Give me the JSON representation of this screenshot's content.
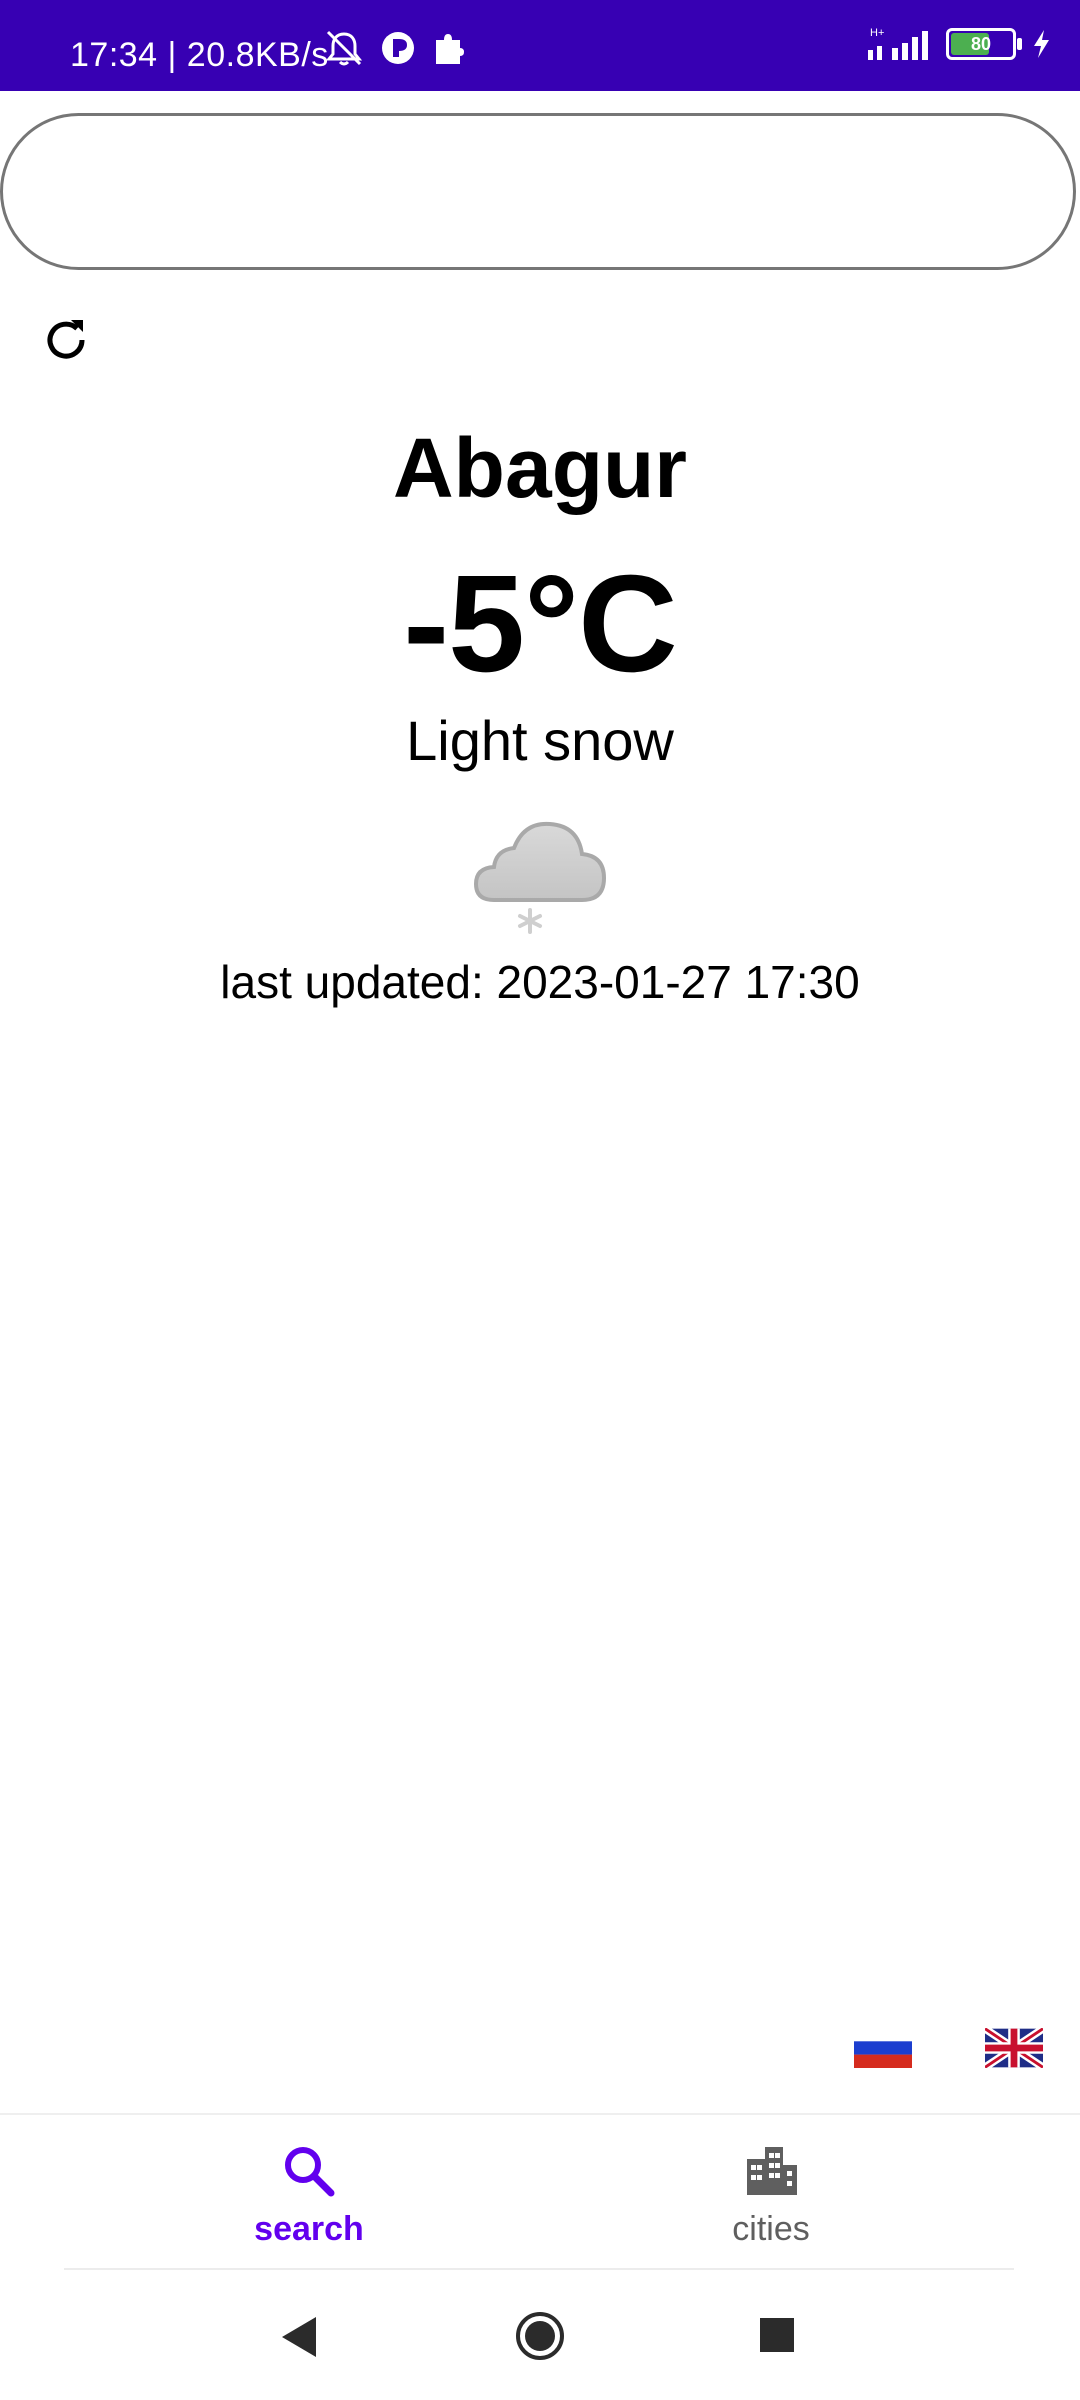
{
  "status_bar": {
    "time_speed": "17:34 | 20.8KB/s",
    "network": "H+",
    "battery_level": "80",
    "icons": [
      "mute-icon",
      "app-icon",
      "puzzle-icon",
      "signal-icon",
      "battery-icon",
      "charging-icon"
    ]
  },
  "search": {
    "value": "",
    "placeholder": ""
  },
  "weather": {
    "city": "Abagur",
    "temperature": "-5°C",
    "condition": "Light snow",
    "icon": "cloud-snow-icon",
    "last_updated": "last updated: 2023-01-27 17:30"
  },
  "languages": [
    {
      "name": "russian-flag"
    },
    {
      "name": "uk-flag"
    }
  ],
  "bottom_nav": {
    "items": [
      {
        "label": "search",
        "icon": "search-icon",
        "active": true
      },
      {
        "label": "cities",
        "icon": "city-icon",
        "active": false
      }
    ]
  },
  "colors": {
    "accent": "#6200ee",
    "status_bar": "#3700b3",
    "inactive": "#5f5f5f"
  }
}
